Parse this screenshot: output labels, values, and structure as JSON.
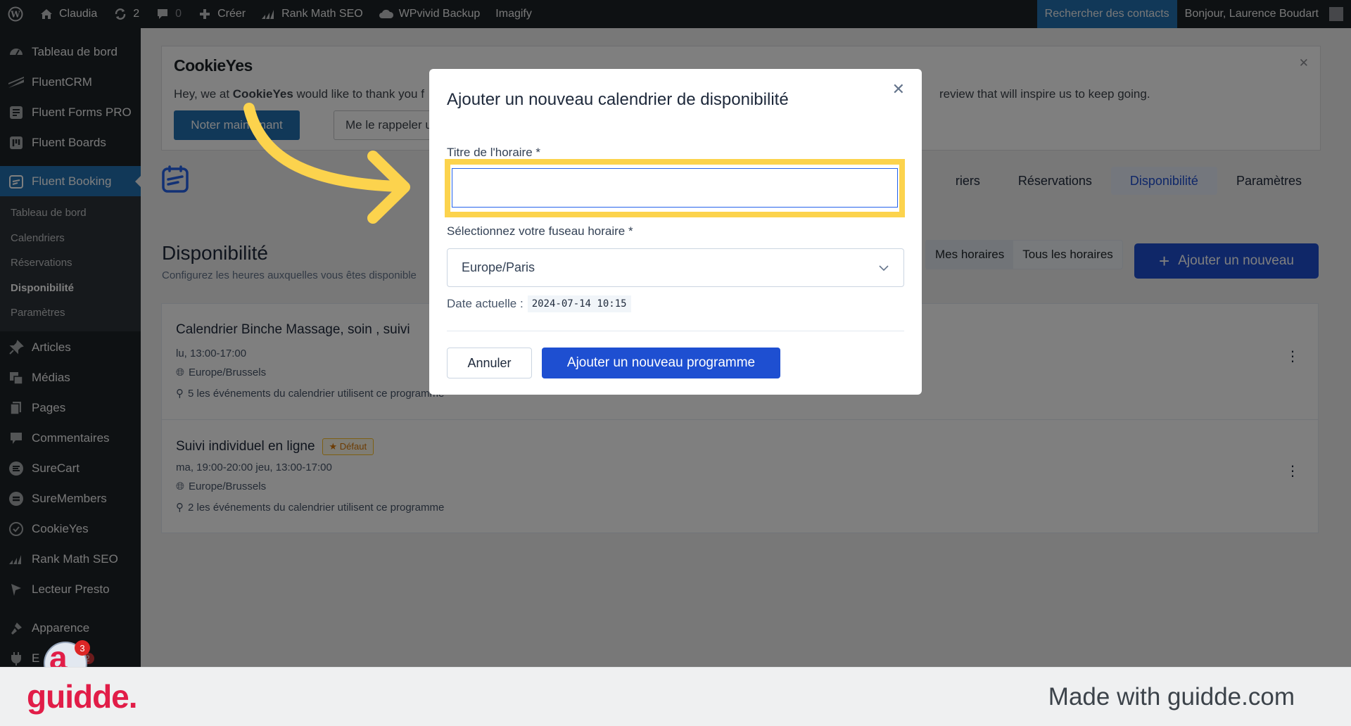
{
  "admin_bar": {
    "site": "Claudia",
    "updates": "2",
    "comments": "0",
    "new": "Créer",
    "items": [
      "Rank Math SEO",
      "WPvivid Backup",
      "Imagify"
    ],
    "search": "Rechercher des contacts",
    "greeting": "Bonjour, Laurence Boudart"
  },
  "sidebar": {
    "top": [
      {
        "label": "Tableau de bord",
        "icon": "dashboard-icon"
      },
      {
        "label": "FluentCRM",
        "icon": "fluentcrm-icon"
      },
      {
        "label": "Fluent Forms PRO",
        "icon": "forms-icon"
      },
      {
        "label": "Fluent Boards",
        "icon": "boards-icon"
      }
    ],
    "active": "Fluent Booking",
    "submenu": [
      "Tableau de bord",
      "Calendriers",
      "Réservations",
      "Disponibilité",
      "Paramètres"
    ],
    "current_submenu": "Disponibilité",
    "bottom": [
      {
        "label": "Articles",
        "icon": "pin-icon"
      },
      {
        "label": "Médias",
        "icon": "media-icon"
      },
      {
        "label": "Pages",
        "icon": "pages-icon"
      },
      {
        "label": "Commentaires",
        "icon": "comment-icon"
      },
      {
        "label": "SureCart",
        "icon": "surecart-icon"
      },
      {
        "label": "SureMembers",
        "icon": "suremembers-icon"
      },
      {
        "label": "CookieYes",
        "icon": "cookie-icon"
      },
      {
        "label": "Rank Math SEO",
        "icon": "rankmath-icon"
      },
      {
        "label": "Lecteur Presto",
        "icon": "presto-icon"
      },
      {
        "label": "Apparence",
        "icon": "brush-icon"
      }
    ],
    "plugins_partial": "E",
    "plugins_partial_end": "s",
    "plugins_count": "2"
  },
  "notice": {
    "logo": "CookieYes",
    "message_start": "Hey, we at ",
    "message_brand": "CookieYes",
    "message_mid": " would like to thank you f",
    "message_end": "review that will inspire us to keep going.",
    "rate_button": "Noter maintenant",
    "remind_button": "Me le rappeler ulté"
  },
  "tabs": [
    "riers",
    "Réservations",
    "Disponibilité",
    "Paramètres"
  ],
  "current_tab": "Disponibilité",
  "page": {
    "title": "Disponibilité",
    "description": "Configurez les heures auxquelles vous êtes disponible",
    "filter_mine": "Mes horaires",
    "filter_all": "Tous les horaires",
    "add_button": "Ajouter un nouveau"
  },
  "schedules": [
    {
      "name": "Calendrier Binche Massage, soin , suivi",
      "hours": "lu, 13:00-17:00",
      "timezone": "Europe/Brussels",
      "usage": "5 les événements du calendrier utilisent ce programme",
      "badge": ""
    },
    {
      "name": "Suivi individuel en ligne",
      "hours": "ma, 19:00-20:00   jeu, 13:00-17:00",
      "timezone": "Europe/Brussels",
      "usage": "2 les événements du calendrier utilisent ce programme",
      "badge": "Défaut"
    }
  ],
  "modal": {
    "title": "Ajouter un nouveau calendrier de disponibilité",
    "field_title_label": "Titre de l'horaire *",
    "field_title_value": "",
    "timezone_label": "Sélectionnez votre fuseau horaire *",
    "timezone_value": "Europe/Paris",
    "date_label": "Date actuelle :",
    "date_value": "2024-07-14 10:15",
    "cancel": "Annuler",
    "submit": "Ajouter un nouveau programme"
  },
  "bubble_count": "3",
  "footer": {
    "brand": "guidde.",
    "made_with": "Made with guidde.com"
  },
  "colors": {
    "wp_dark": "#1d2327",
    "wp_blue": "#2271b1",
    "primary": "#1e4fd1",
    "highlight": "#fcd34d",
    "arrow": "#fcd34d",
    "brand": "#e11d48"
  }
}
